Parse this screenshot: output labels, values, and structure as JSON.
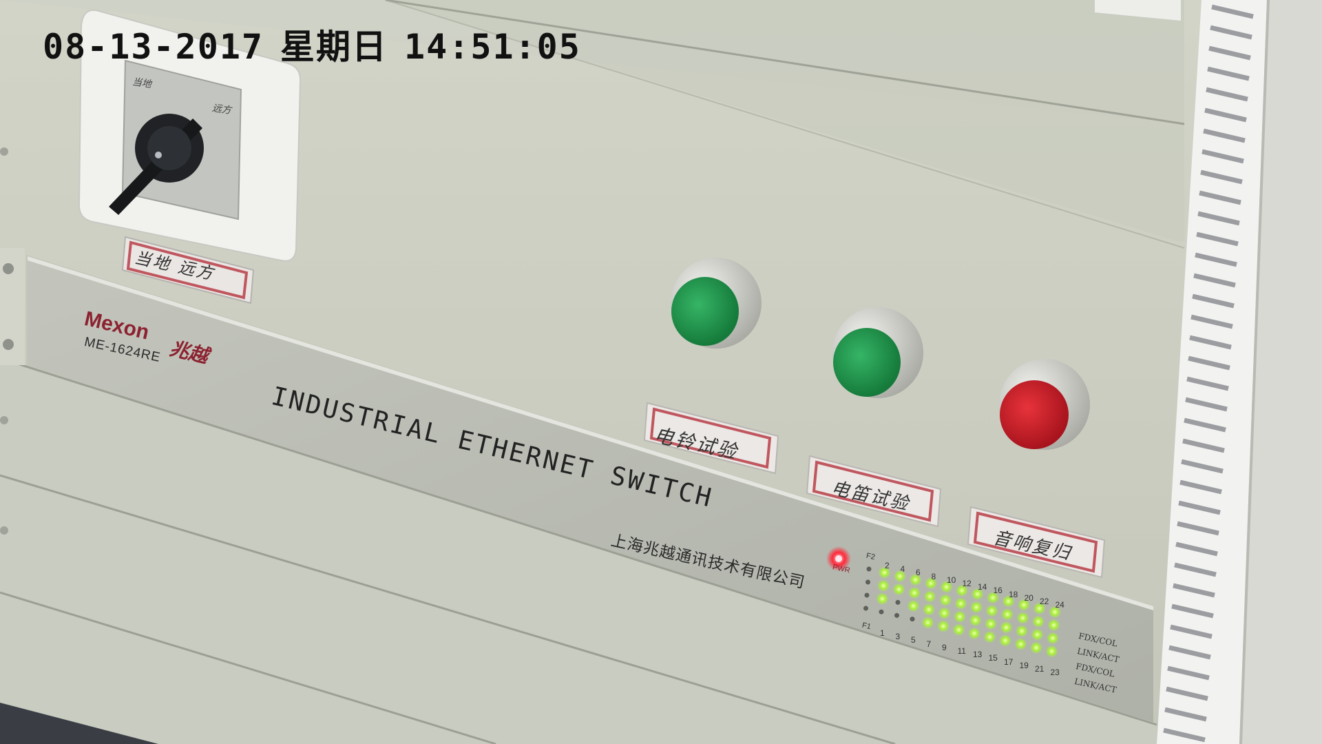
{
  "overlay": {
    "date": "08-13-2017",
    "weekday": "星期日",
    "time": "14:51:05"
  },
  "panel": {
    "brand": "Mexon",
    "brand_cn": "兆越",
    "model": "ME-1624RE",
    "headline": "INDUSTRIAL ETHERNET SWITCH",
    "company": "上海兆越通讯技术有限公司",
    "power_label": "PWR"
  },
  "selector_switch": {
    "left_mark": "当地",
    "right_mark": "远方",
    "label": "当地 远方"
  },
  "buttons": [
    {
      "label": "电铃试验",
      "color": "#1f9a4e"
    },
    {
      "label": "电笛试验",
      "color": "#1f9a4e"
    },
    {
      "label": "音响复归",
      "color": "#d0202a"
    }
  ],
  "port_panel": {
    "top_left": "F2",
    "bottom_left": "F1",
    "top_numbers": [
      "2",
      "4",
      "6",
      "8",
      "10",
      "12",
      "14",
      "16",
      "18",
      "20",
      "22",
      "24"
    ],
    "bottom_numbers": [
      "1",
      "3",
      "5",
      "7",
      "9",
      "11",
      "13",
      "15",
      "17",
      "19",
      "21",
      "23"
    ],
    "legend": [
      "FDX/COL",
      "LINK/ACT",
      "FDX/COL",
      "LINK/ACT"
    ]
  },
  "colors": {
    "cabinet": "#c9ccc0",
    "panel_face": "#b6b8b0",
    "brand_red": "#8c2230",
    "led_green": "#a8f03a",
    "led_red": "#ff2a3a"
  }
}
